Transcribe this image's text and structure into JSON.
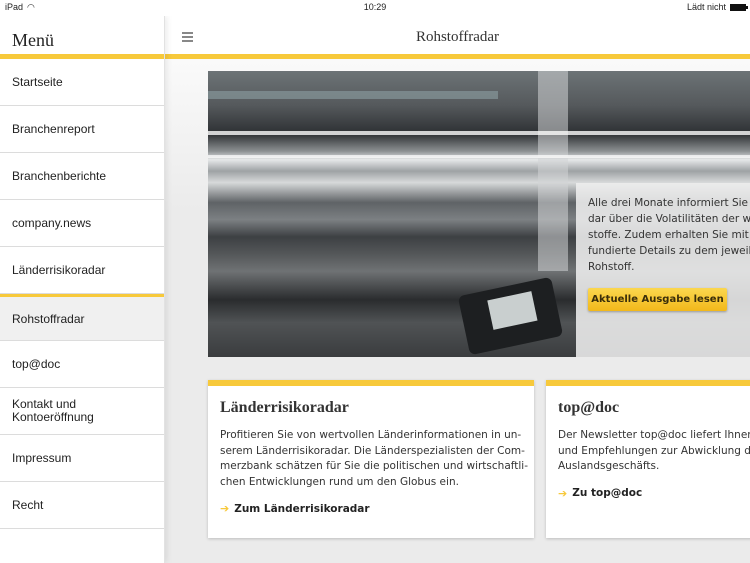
{
  "status_bar": {
    "device": "iPad",
    "time": "10:29",
    "battery_status": "Lädt nicht",
    "icons": [
      "wifi-icon",
      "battery-icon"
    ]
  },
  "sidebar": {
    "title": "Menü",
    "items": [
      {
        "label": "Startseite",
        "active": false
      },
      {
        "label": "Branchenreport",
        "active": false
      },
      {
        "label": "Branchenberichte",
        "active": false
      },
      {
        "label": "company.news",
        "active": false
      },
      {
        "label": "Länderrisikoradar",
        "active": false
      },
      {
        "label": "Rohstoffradar",
        "active": true
      },
      {
        "label": "top@doc",
        "active": false
      },
      {
        "label": "Kontakt und\nKontoeröffnung",
        "active": false
      },
      {
        "label": "Impressum",
        "active": false
      },
      {
        "label": "Recht",
        "active": false
      }
    ]
  },
  "header": {
    "title": "Rohstoffradar",
    "menu_icon": "hamburger-icon"
  },
  "hero": {
    "text_lines": [
      "Alle drei Monate informiert Sie d",
      "dar über die Volatilitäten der wi",
      "stoffe. Zudem erhalten Sie mit j",
      "fundierte Details zu dem jeweili",
      "Rohstoff."
    ],
    "button_label": "Aktuelle Ausgabe lesen"
  },
  "cards": [
    {
      "title": "Länderrisikoradar",
      "text_lines": [
        "Profitieren Sie von wertvollen Länderinformationen in un-",
        "serem Länderrisikoradar. Die Länderspezialisten der Com-",
        "merzbank schätzen für Sie die politischen und wirtschaftli-",
        "chen Entwicklungen rund um den Globus ein."
      ],
      "link_label": "Zum Länderrisikoradar"
    },
    {
      "title": "top@doc",
      "text_lines": [
        "Der Newsletter top@doc liefert Ihnen",
        "und Empfehlungen zur Abwicklung de",
        "Auslandsgeschäfts."
      ],
      "link_label": "Zu top@doc"
    }
  ],
  "colors": {
    "accent": "#f7c93b",
    "button": "#f2b81a",
    "background": "#ebebeb"
  }
}
